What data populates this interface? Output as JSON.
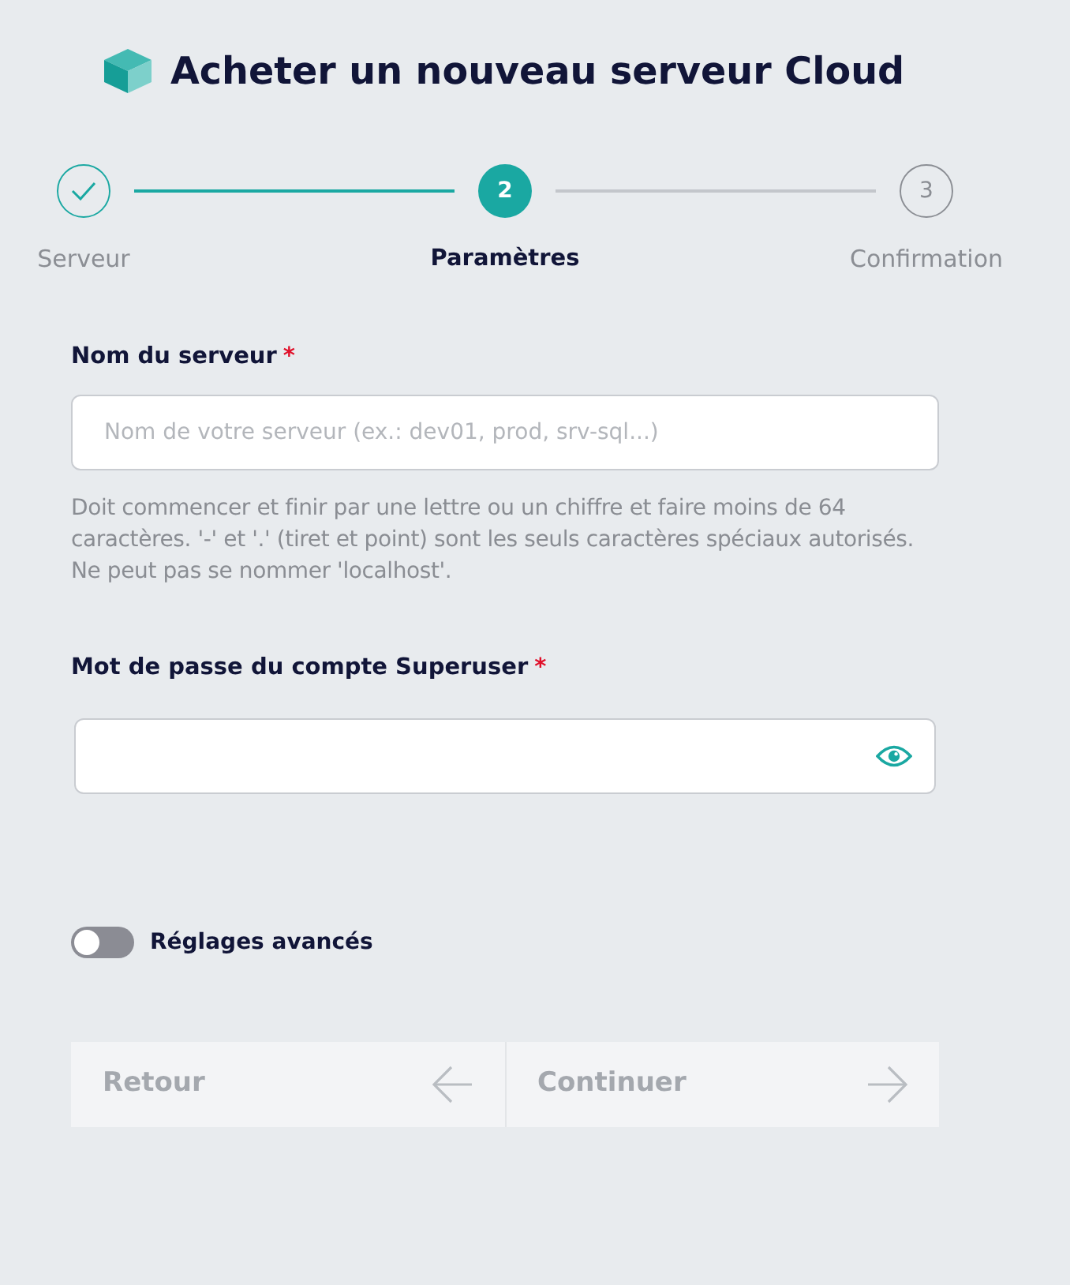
{
  "header": {
    "title": "Acheter un nouveau serveur Cloud"
  },
  "steps": [
    {
      "label": "Serveur",
      "completed": true,
      "current": false
    },
    {
      "label": "Paramètres",
      "number": "2",
      "completed": false,
      "current": true
    },
    {
      "label": "Confirmation",
      "number": "3",
      "completed": false,
      "current": false
    }
  ],
  "fields": [
    {
      "kind": "text",
      "label": "Nom du serveur",
      "required_mark": "*",
      "placeholder": "Nom de votre serveur (ex.: dev01, prod, srv-sql...)",
      "help": "Doit commencer et finir par une lettre ou un chiffre et faire moins de 64 caractères. '-' et '.' (tiret et point) sont les seuls caractères spéciaux autorisés. Ne peut pas se nommer 'localhost'."
    },
    {
      "kind": "password",
      "label": "Mot de passe du compte Superuser",
      "required_mark": "*"
    }
  ],
  "advanced_settings": {
    "label": "Réglages avancés",
    "on": false
  },
  "buttons": [
    {
      "kind": "back",
      "label": "Retour",
      "disabled": true
    },
    {
      "kind": "next",
      "label": "Continuer",
      "disabled": true
    }
  ]
}
